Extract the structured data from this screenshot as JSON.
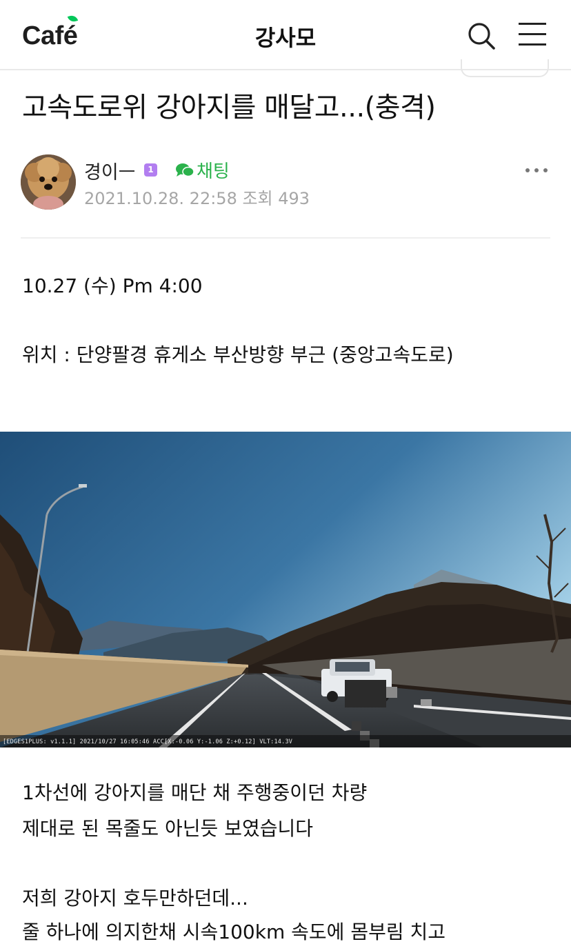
{
  "header": {
    "logo_text": "Caf",
    "logo_text_accent": "é",
    "cafe_name": "강사모",
    "brand_color": "#03c75a"
  },
  "post": {
    "title": "고속도로위 강아지를 매달고...(충격)",
    "author": {
      "name": "경이ㅡ",
      "level": "1",
      "chat_label": "채팅"
    },
    "meta": "2021.10.28. 22:58 조회 493",
    "body": {
      "line1": "10.27 (수) Pm 4:00",
      "line2": "위치 : 단양팔경 휴게소 부산방향 부근 (중앙고속도로)",
      "osd_text": "[EDGES1PLUS: v1.1.1] 2021/10/27 16:05:46 ACC[X:-0.06 Y:-1.06 Z:+0.12] VLT:14.3V",
      "line3": "1차선에 강아지를 매단 채 주행중이던 차량",
      "line4": "제대로 된 목줄도 아닌듯 보였습니다",
      "line5": "저희 강아지 호두만하던데...",
      "line6": "줄 하나에 의지한채 시속100km 속도에 몸부림 치고"
    }
  },
  "icons": {
    "search": "search-icon",
    "menu": "hamburger-menu-icon",
    "chat": "chat-bubble-icon",
    "more": "more-dots-icon"
  }
}
